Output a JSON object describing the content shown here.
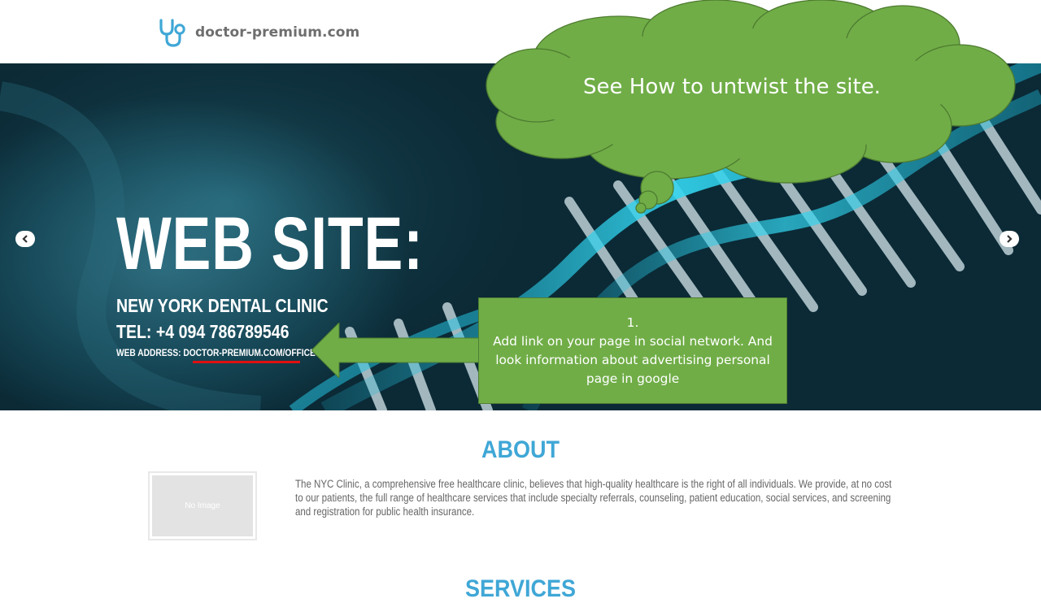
{
  "site": {
    "logo_text": "doctor-premium.com"
  },
  "hero": {
    "title": "WEB SITE:",
    "clinic": "NEW YORK DENTAL CLINIC",
    "tel": "TEL: +4 094 786789546",
    "web_address": "WEB ADDRESS: DOCTOR-PREMIUM.COM/OFFICE3"
  },
  "about": {
    "heading": "ABOUT",
    "image_placeholder": "No Image",
    "text": "The NYC Clinic, a comprehensive free healthcare clinic, believes that high-quality healthcare is the right of all individuals. We provide, at no cost to our patients, the full range of healthcare services that include specialty referrals, counseling, patient education, social services, and screening and registration for public health insurance."
  },
  "services": {
    "heading": "SERVICES"
  },
  "annotations": {
    "cloud_text": "See How to untwist the site.",
    "callout_number": "1.",
    "callout_text": "Add link on your page in social network. And look information about advertising personal page in google"
  },
  "colors": {
    "accent": "#3fa7d6",
    "annotation_green": "#70ad47",
    "underline_red": "#e01010"
  }
}
